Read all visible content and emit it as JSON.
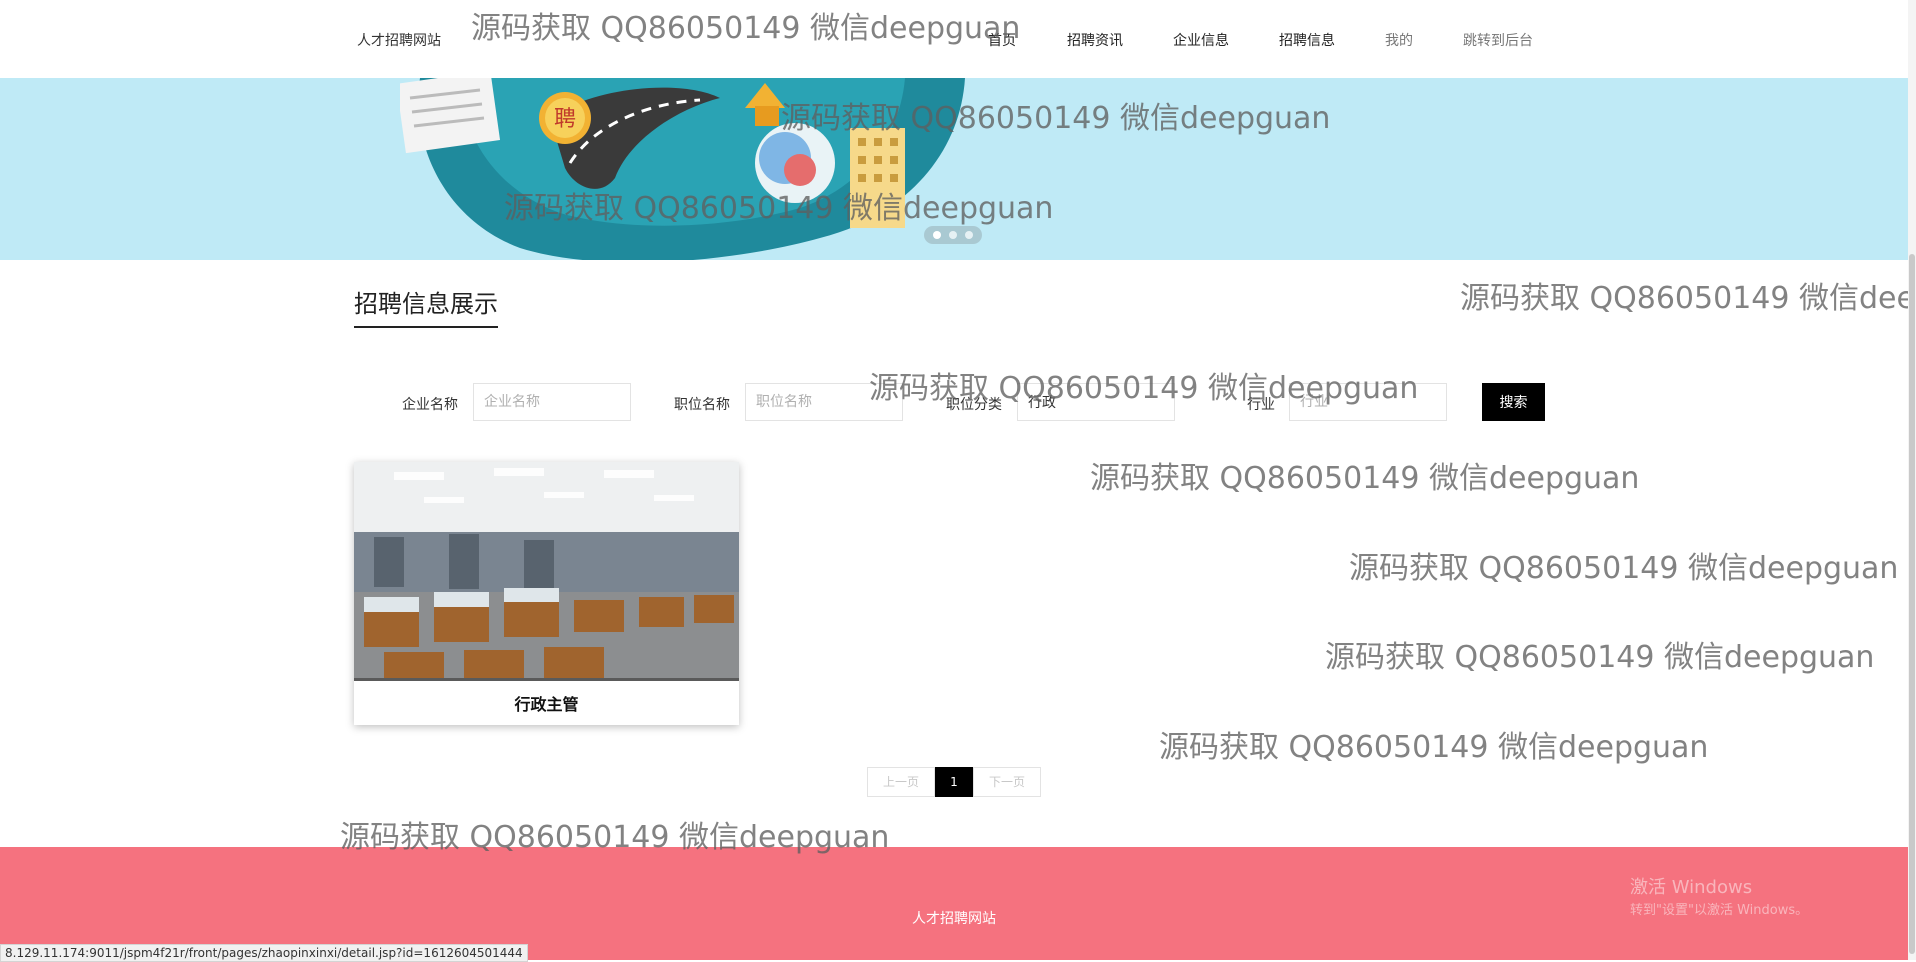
{
  "header": {
    "site_name": "人才招聘网站",
    "nav": [
      "首页",
      "招聘资讯",
      "企业信息",
      "招聘信息",
      "我的",
      "跳转到后台"
    ]
  },
  "banner": {
    "slide_sign": "聘",
    "slide_count": 3,
    "active_slide": 1
  },
  "section": {
    "title": "招聘信息展示"
  },
  "search": {
    "company_label": "企业名称",
    "company_placeholder": "企业名称",
    "company_value": "",
    "position_label": "职位名称",
    "position_placeholder": "职位名称",
    "position_value": "",
    "category_label": "职位分类",
    "category_value": "行政",
    "industry_label": "行业",
    "industry_placeholder": "行业",
    "industry_value": "",
    "button": "搜索"
  },
  "cards": [
    {
      "title": "行政主管"
    }
  ],
  "pagination": {
    "prev": "上一页",
    "current": "1",
    "next": "下一页"
  },
  "footer": {
    "site_name": "人才招聘网站",
    "activate_title": "激活 Windows",
    "activate_sub": "转到\"设置\"以激活 Windows。"
  },
  "status_url": "8.129.11.174:9011/jspm4f21r/front/pages/zhaopinxinxi/detail.jsp?id=1612604501444",
  "watermark": "源码获取 QQ86050149 微信deepguan",
  "colors": {
    "banner_bg": "#bfeaf6",
    "footer_bg": "#f5727f",
    "button_bg": "#000000"
  }
}
